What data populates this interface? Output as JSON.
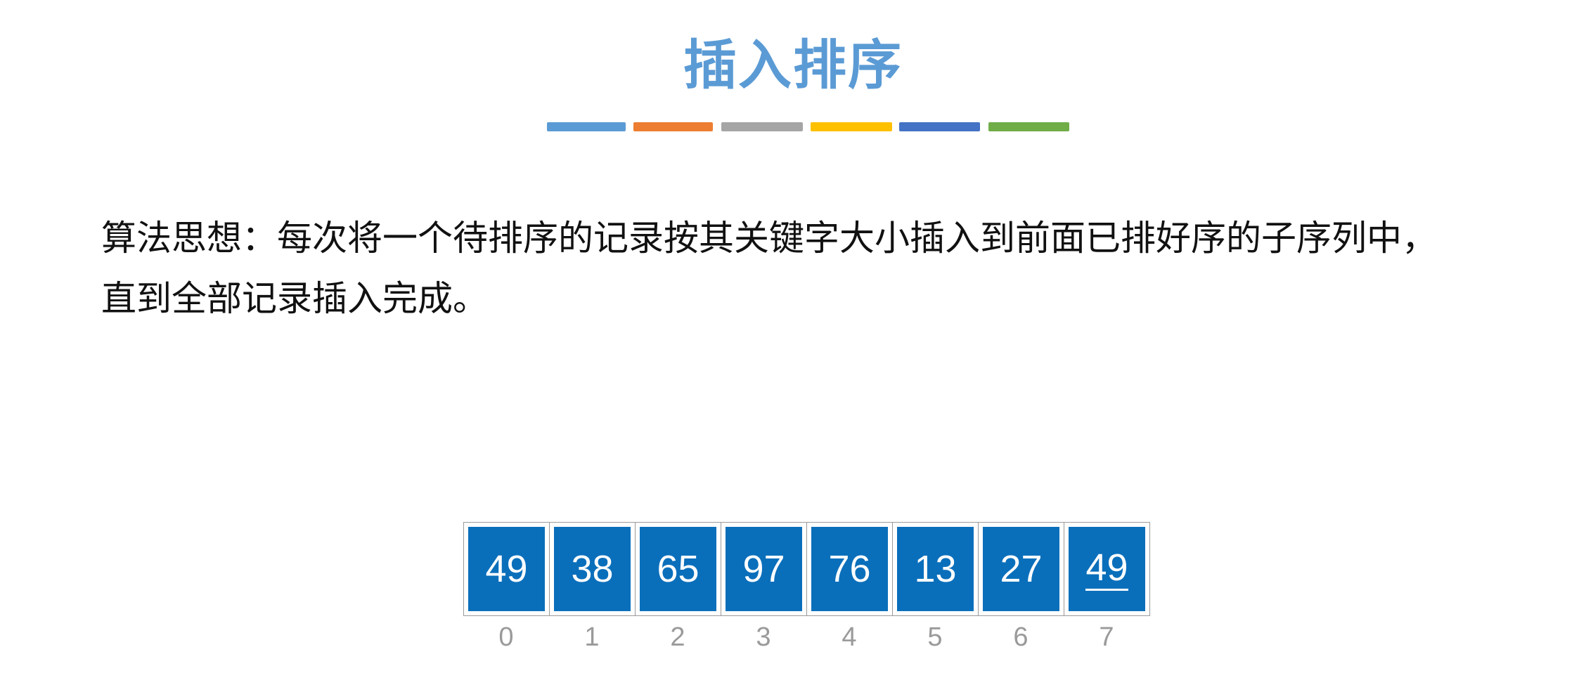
{
  "title": "插入排序",
  "palette_bars": [
    {
      "color": "#5b9bd5"
    },
    {
      "color": "#ed7d31"
    },
    {
      "color": "#a5a5a5"
    },
    {
      "color": "#ffc000"
    },
    {
      "color": "#4472c4"
    },
    {
      "color": "#70ad47"
    }
  ],
  "description": {
    "line1": "算法思想：每次将一个待排序的记录按其关键字大小插入到前面已排好序的子序列中，",
    "line2": "直到全部记录插入完成。"
  },
  "array": {
    "values": [
      "49",
      "38",
      "65",
      "97",
      "76",
      "13",
      "27",
      "49"
    ],
    "indices": [
      "0",
      "1",
      "2",
      "3",
      "4",
      "5",
      "6",
      "7"
    ],
    "underlined_index": 7,
    "cell_color": "#0a6fbb"
  },
  "colors": {
    "title": "#5b9bd5",
    "index_text": "#9a9a9a"
  }
}
